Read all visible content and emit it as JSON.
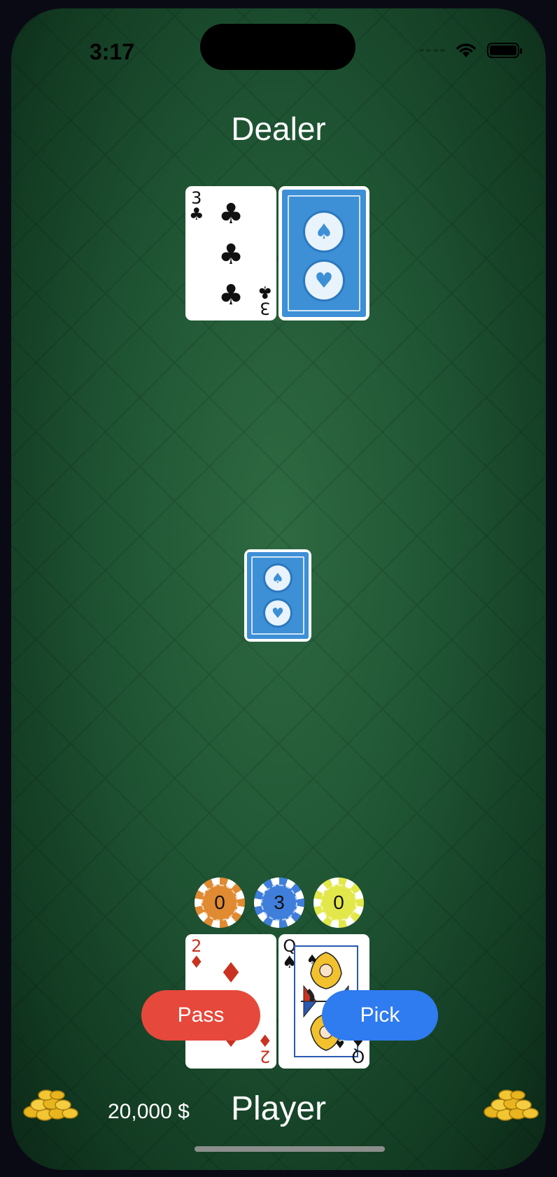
{
  "status_bar": {
    "time": "3:17"
  },
  "dealer": {
    "label": "Dealer",
    "cards": [
      {
        "rank": "3",
        "suit": "♣",
        "color": "black",
        "face_up": true
      },
      {
        "face_up": false
      }
    ]
  },
  "deck": {
    "face_up": false
  },
  "chips": [
    {
      "value": "0",
      "color": "#e08a32"
    },
    {
      "value": "3",
      "color": "#3f7fdb"
    },
    {
      "value": "0",
      "color": "#e3e84a"
    }
  ],
  "player": {
    "label": "Player",
    "money": "20,000 $",
    "cards": [
      {
        "rank": "2",
        "suit": "♦",
        "color": "red",
        "face_up": true
      },
      {
        "rank": "Q",
        "suit": "♠",
        "color": "black",
        "face_up": true
      }
    ]
  },
  "actions": {
    "pass_label": "Pass",
    "pick_label": "Pick"
  },
  "icons": {
    "coins_left": "coin-pile-icon",
    "coins_right": "coin-pile-icon",
    "wifi": "wifi-icon",
    "battery": "battery-icon"
  }
}
